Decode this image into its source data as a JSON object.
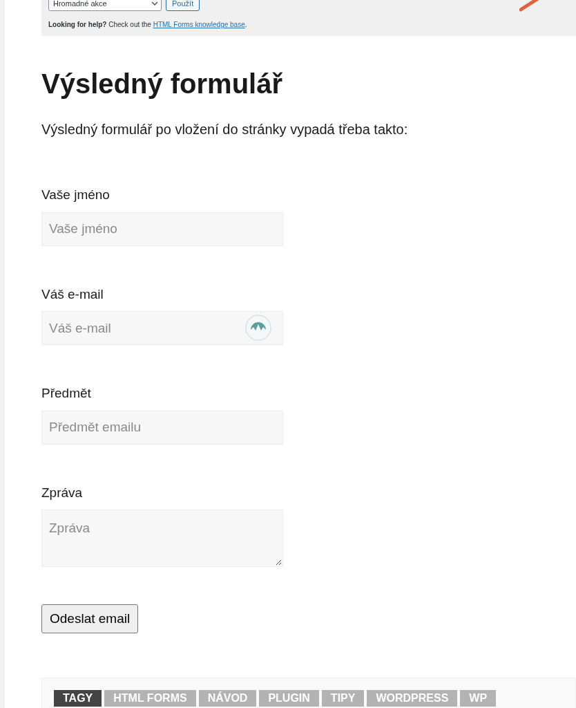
{
  "screenshot": {
    "bulk_select": "Hromadné akce",
    "apply_button": "Použít",
    "help": {
      "lead": "Looking for help?",
      "text": " Check out the ",
      "link": "HTML Forms knowledge base",
      "end": "."
    }
  },
  "heading": "Výsledný formulář",
  "intro": "Výsledný formulář po vložení do stránky vypadá třeba takto:",
  "fields": [
    {
      "kind": "input",
      "label": "Vaše jméno",
      "placeholder": "Vaše jméno",
      "autofill_icon": false
    },
    {
      "kind": "input",
      "label": "Váš e-mail",
      "placeholder": "Váš e-mail",
      "autofill_icon": true
    },
    {
      "kind": "input",
      "label": "Předmět",
      "placeholder": "Předmět emailu",
      "autofill_icon": false
    },
    {
      "kind": "textarea",
      "label": "Zpráva",
      "placeholder": "Zpráva",
      "autofill_icon": false
    }
  ],
  "submit": "Odeslat email",
  "tags_label": "TAGY",
  "tags": [
    "HTML FORMS",
    "NÁVOD",
    "PLUGIN",
    "TIPY",
    "WORDPRESS",
    "WP"
  ]
}
